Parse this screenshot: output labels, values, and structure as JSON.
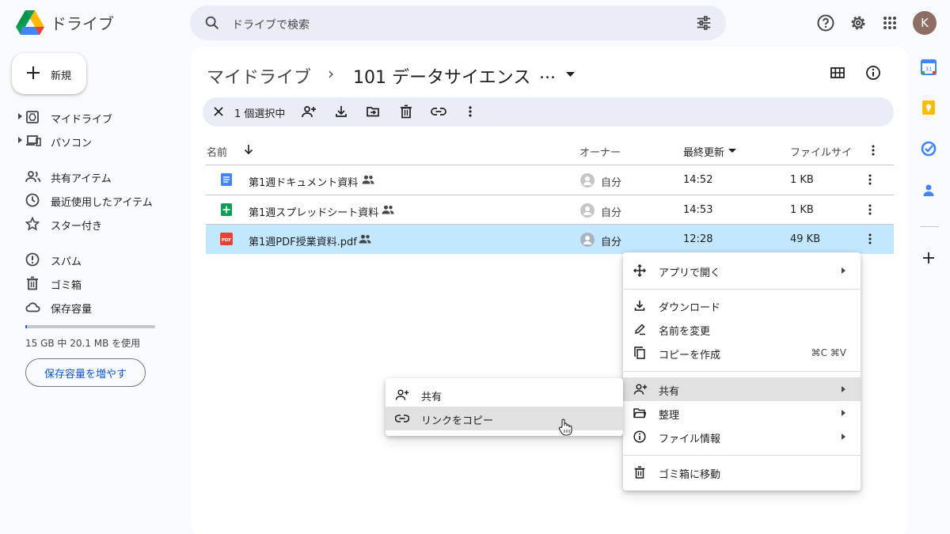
{
  "app": {
    "title": "ドライブ"
  },
  "search": {
    "placeholder": "ドライブで検索"
  },
  "user": {
    "avatar_letter": "K"
  },
  "sidebar": {
    "new_label": "新規",
    "items": [
      {
        "label": "マイドライブ",
        "icon": "drive-folder-icon"
      },
      {
        "label": "パソコン",
        "icon": "computer-icon"
      },
      {
        "label": "共有アイテム",
        "icon": "people-icon"
      },
      {
        "label": "最近使用したアイテム",
        "icon": "clock-icon"
      },
      {
        "label": "スター付き",
        "icon": "star-icon"
      },
      {
        "label": "スパム",
        "icon": "spam-icon"
      },
      {
        "label": "ゴミ箱",
        "icon": "trash-icon"
      },
      {
        "label": "保存容量",
        "icon": "cloud-icon"
      }
    ],
    "storage_text": "15 GB 中 20.1 MB を使用",
    "storage_used_fraction": 0.0013,
    "storage_button": "保存容量を増やす"
  },
  "breadcrumb": {
    "root": "マイドライブ",
    "separator": "›",
    "current": "101 データサイエンス",
    "ellipsis": "..."
  },
  "selection": {
    "count_label": "1 個選択中"
  },
  "table": {
    "headers": {
      "name": "名前",
      "owner": "オーナー",
      "modified": "最終更新",
      "size": "ファイルサイ"
    },
    "rows": [
      {
        "name": "第1週ドキュメント資料",
        "type": "docs",
        "owner": "自分",
        "modified": "14:52",
        "size": "1 KB",
        "selected": false
      },
      {
        "name": "第1週スプレッドシート資料",
        "type": "sheets",
        "owner": "自分",
        "modified": "14:53",
        "size": "1 KB",
        "selected": false
      },
      {
        "name": "第1週PDF授業資料.pdf",
        "type": "pdf",
        "owner": "自分",
        "modified": "12:28",
        "size": "49 KB",
        "selected": true
      }
    ],
    "pdf_badge": "PDF"
  },
  "context_menu": {
    "open_with": "アプリで開く",
    "download": "ダウンロード",
    "rename": "名前を変更",
    "make_copy": "コピーを作成",
    "make_copy_shortcut": "⌘C ⌘V",
    "share": "共有",
    "organize": "整理",
    "file_info": "ファイル情報",
    "move_to_trash": "ゴミ箱に移動"
  },
  "share_submenu": {
    "share": "共有",
    "copy_link": "リンクをコピー"
  },
  "colors": {
    "accent": "#0b57d0",
    "selected_row": "#c2e7ff",
    "search_bg": "#e9eef6",
    "page_bg": "#f8fafd",
    "menu_highlight": "#e1e1e1"
  }
}
